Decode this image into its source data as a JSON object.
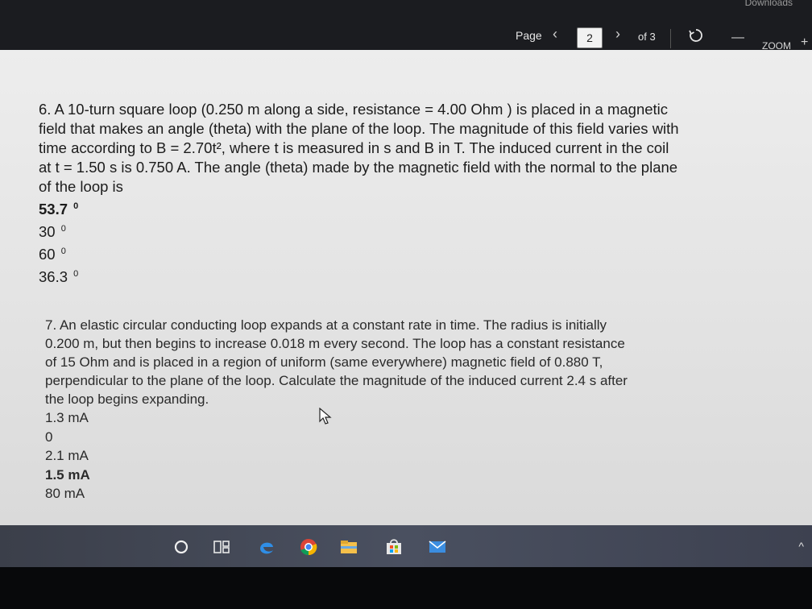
{
  "toolbar": {
    "partial_title": "Downloads",
    "page_label": "Page",
    "prev_icon": "chevron-left-icon",
    "current_page": "2",
    "next_icon": "chevron-right-icon",
    "of_label": "of 3",
    "rotate_icon": "rotate-icon",
    "zoom_minus": "—",
    "zoom_label": "ZOOM",
    "zoom_plus": "+"
  },
  "question6": {
    "lines": [
      "6. A 10-turn square loop (0.250 m along a side, resistance = 4.00 Ohm ) is placed in a magnetic",
      "field that makes an angle (theta) with the plane of the loop. The magnitude of this field varies with",
      "time according to B = 2.70t², where t is measured in s and B in T. The induced current in the coil",
      "at t = 1.50 s is 0.750 A. The angle (theta) made by the magnetic field with the normal to the plane",
      "of the loop is"
    ],
    "options": [
      {
        "value": "53.7",
        "unit": "0"
      },
      {
        "value": "30",
        "unit": "0"
      },
      {
        "value": "60",
        "unit": "0"
      },
      {
        "value": "36.3",
        "unit": "0"
      }
    ]
  },
  "question7": {
    "lines": [
      "7. An elastic circular conducting loop expands at a constant rate in time. The radius is initially",
      "0.200 m, but then begins to increase 0.018 m every second. The loop has a constant resistance",
      "of 15  Ohm and is placed in a region of uniform (same everywhere) magnetic field of 0.880 T,",
      "perpendicular to the plane of the loop. Calculate the magnitude of the induced current 2.4 s after",
      "the loop begins expanding."
    ],
    "options": [
      "1.3 mA",
      "0",
      "2.1 mA",
      "1.5 mA",
      "80 mA"
    ]
  },
  "taskbar": {
    "items": [
      "cortana-icon",
      "task-view-icon",
      "edge-icon",
      "chrome-icon",
      "file-explorer-icon",
      "store-icon",
      "mail-icon"
    ],
    "tray": "^"
  },
  "colors": {
    "toolbar_bg": "#1b1c20",
    "page_bg": "#e6e6e6",
    "text": "#1c1c1c",
    "taskbar_bg": "#454a58"
  }
}
